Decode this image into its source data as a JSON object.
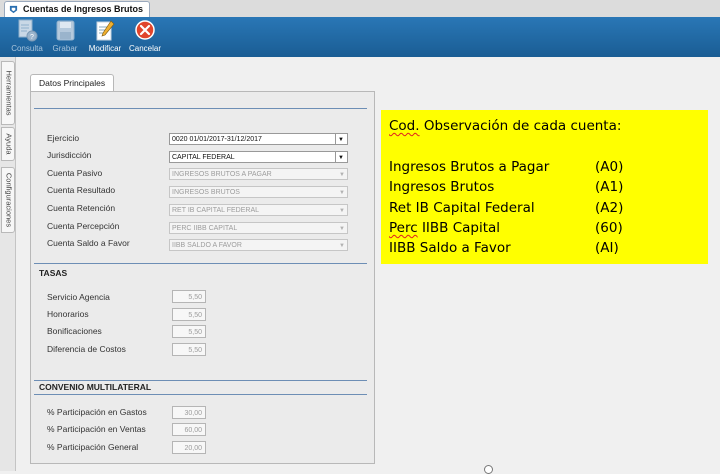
{
  "window": {
    "tab_title": "Cuentas de Ingresos Brutos"
  },
  "toolbar": {
    "buttons": [
      {
        "label": "Consulta",
        "icon": "query-icon",
        "enabled": false
      },
      {
        "label": "Grabar",
        "icon": "save-icon",
        "enabled": false
      },
      {
        "label": "Modificar",
        "icon": "edit-icon",
        "enabled": true
      },
      {
        "label": "Cancelar",
        "icon": "cancel-icon",
        "enabled": true
      }
    ]
  },
  "side_tabs": [
    "Herramientas",
    "Ayuda",
    "Configuraciones"
  ],
  "panel": {
    "tab_label": "Datos Principales",
    "fields": [
      {
        "label": "Ejercicio",
        "value": "0020 01/01/2017-31/12/2017",
        "enabled": true
      },
      {
        "label": "Jurisdicción",
        "value": "CAPITAL FEDERAL",
        "enabled": true
      },
      {
        "label": "Cuenta Pasivo",
        "value": "INGRESOS BRUTOS A PAGAR",
        "enabled": false
      },
      {
        "label": "Cuenta Resultado",
        "value": "INGRESOS BRUTOS",
        "enabled": false
      },
      {
        "label": "Cuenta Retención",
        "value": "RET IB CAPITAL FEDERAL",
        "enabled": false
      },
      {
        "label": "Cuenta Percepción",
        "value": "PERC IIBB CAPITAL",
        "enabled": false
      },
      {
        "label": "Cuenta Saldo a Favor",
        "value": "IIBB SALDO A FAVOR",
        "enabled": false
      }
    ],
    "tasas": {
      "title": "TASAS",
      "rows": [
        {
          "label": "Servicio Agencia",
          "value": "5,50"
        },
        {
          "label": "Honorarios",
          "value": "5,50"
        },
        {
          "label": "Bonificaciones",
          "value": "5,50"
        },
        {
          "label": "Diferencia de Costos",
          "value": "5,50"
        }
      ]
    },
    "convenio": {
      "title": "CONVENIO MULTILATERAL",
      "rows": [
        {
          "label": "% Participación en Gastos",
          "value": "30,00"
        },
        {
          "label": "% Participación en Ventas",
          "value": "60,00"
        },
        {
          "label": "% Participación General",
          "value": "20,00"
        }
      ]
    }
  },
  "note": {
    "title_a": "Cod.",
    "title_b": " Observación de cada cuenta:",
    "items": [
      {
        "name": "Ingresos Brutos a Pagar",
        "code": "(A0)"
      },
      {
        "name": "Ingresos Brutos",
        "code": "(A1)"
      },
      {
        "name": "Ret IB Capital Federal",
        "code": "(A2)"
      },
      {
        "name_a": "Perc",
        "name_b": " IIBB Capital",
        "code": "(60)"
      },
      {
        "name": "IIBB Saldo a Favor",
        "code": "(AI)"
      }
    ],
    "background": "#ffff00"
  },
  "colors": {
    "toolbar": "#1f6aa6",
    "accent_line": "#6d8eb5"
  }
}
